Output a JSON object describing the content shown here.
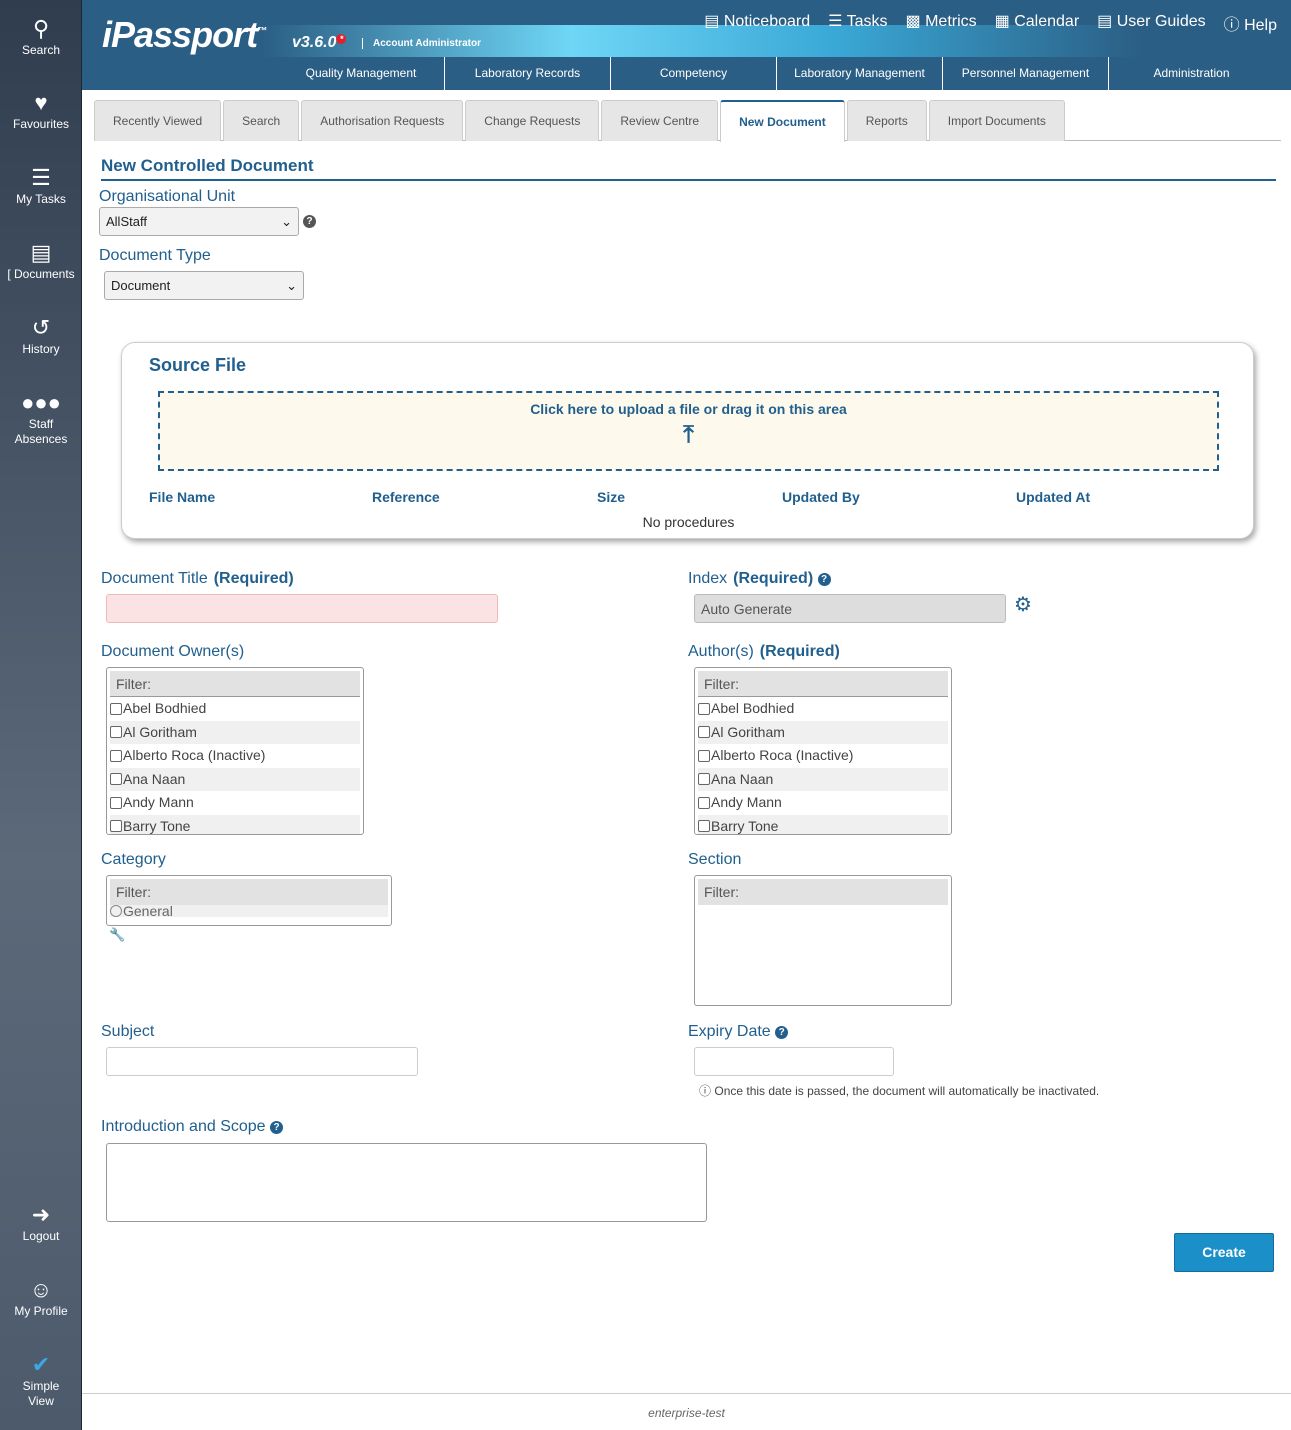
{
  "sidebar": {
    "top": [
      {
        "label": "Search",
        "icon": "search-icon"
      },
      {
        "label": "Favourites",
        "icon": "heart-icon"
      },
      {
        "label": "My Tasks",
        "icon": "tasks-icon"
      },
      {
        "label": "[ Documents",
        "icon": "book-icon"
      },
      {
        "label": "History",
        "icon": "history-icon"
      },
      {
        "label": "Staff Absences",
        "icon": "users-icon"
      }
    ],
    "bottom": [
      {
        "label": "Logout",
        "icon": "logout-icon"
      },
      {
        "label": "My Profile",
        "icon": "user-icon"
      },
      {
        "label": "Simple View",
        "icon": "checkmark-icon"
      }
    ]
  },
  "header": {
    "logo": "iPassport",
    "tm": "™",
    "version": "v3.6.0",
    "version_badge": "*",
    "role": "Account Administrator",
    "links": [
      "Noticeboard",
      "Tasks",
      "Metrics",
      "Calendar",
      "User Guides",
      "Help"
    ],
    "nav": [
      "Quality Management",
      "Laboratory Records",
      "Competency",
      "Laboratory Management",
      "Personnel Management",
      "Administration"
    ]
  },
  "tabs": [
    "Recently Viewed",
    "Search",
    "Authorisation Requests",
    "Change Requests",
    "Review Centre",
    "New Document",
    "Reports",
    "Import Documents"
  ],
  "active_tab": "New Document",
  "page_title": "New Controlled Document",
  "org_unit": {
    "label": "Organisational Unit",
    "value": "AllStaff"
  },
  "doc_type": {
    "label": "Document Type",
    "value": "Document"
  },
  "source": {
    "title": "Source File",
    "upload_text": "Click here to upload a file or drag it on this area",
    "columns": [
      "File Name",
      "Reference",
      "Size",
      "Updated By",
      "Updated At"
    ],
    "empty": "No procedures"
  },
  "required": "(Required)",
  "doc_title": {
    "label": "Document Title",
    "value": ""
  },
  "index": {
    "label": "Index",
    "value": "Auto Generate"
  },
  "owners": {
    "label": "Document Owner(s)",
    "filter": "Filter:",
    "items": [
      "Abel Bodhied",
      "Al Goritham",
      "Alberto Roca (Inactive)",
      "Ana Naan",
      "Andy Mann",
      "Barry Tone"
    ]
  },
  "authors": {
    "label": "Author(s)",
    "filter": "Filter:",
    "items": [
      "Abel Bodhied",
      "Al Goritham",
      "Alberto Roca (Inactive)",
      "Ana Naan",
      "Andy Mann",
      "Barry Tone"
    ]
  },
  "category": {
    "label": "Category",
    "filter": "Filter:",
    "items": [
      "General"
    ]
  },
  "section": {
    "label": "Section",
    "filter": "Filter:"
  },
  "subject": {
    "label": "Subject",
    "value": ""
  },
  "expiry": {
    "label": "Expiry Date",
    "value": "",
    "note": "Once this date is passed, the document will automatically be inactivated."
  },
  "intro": {
    "label": "Introduction and Scope",
    "value": ""
  },
  "create_label": "Create",
  "footer": "enterprise-test"
}
